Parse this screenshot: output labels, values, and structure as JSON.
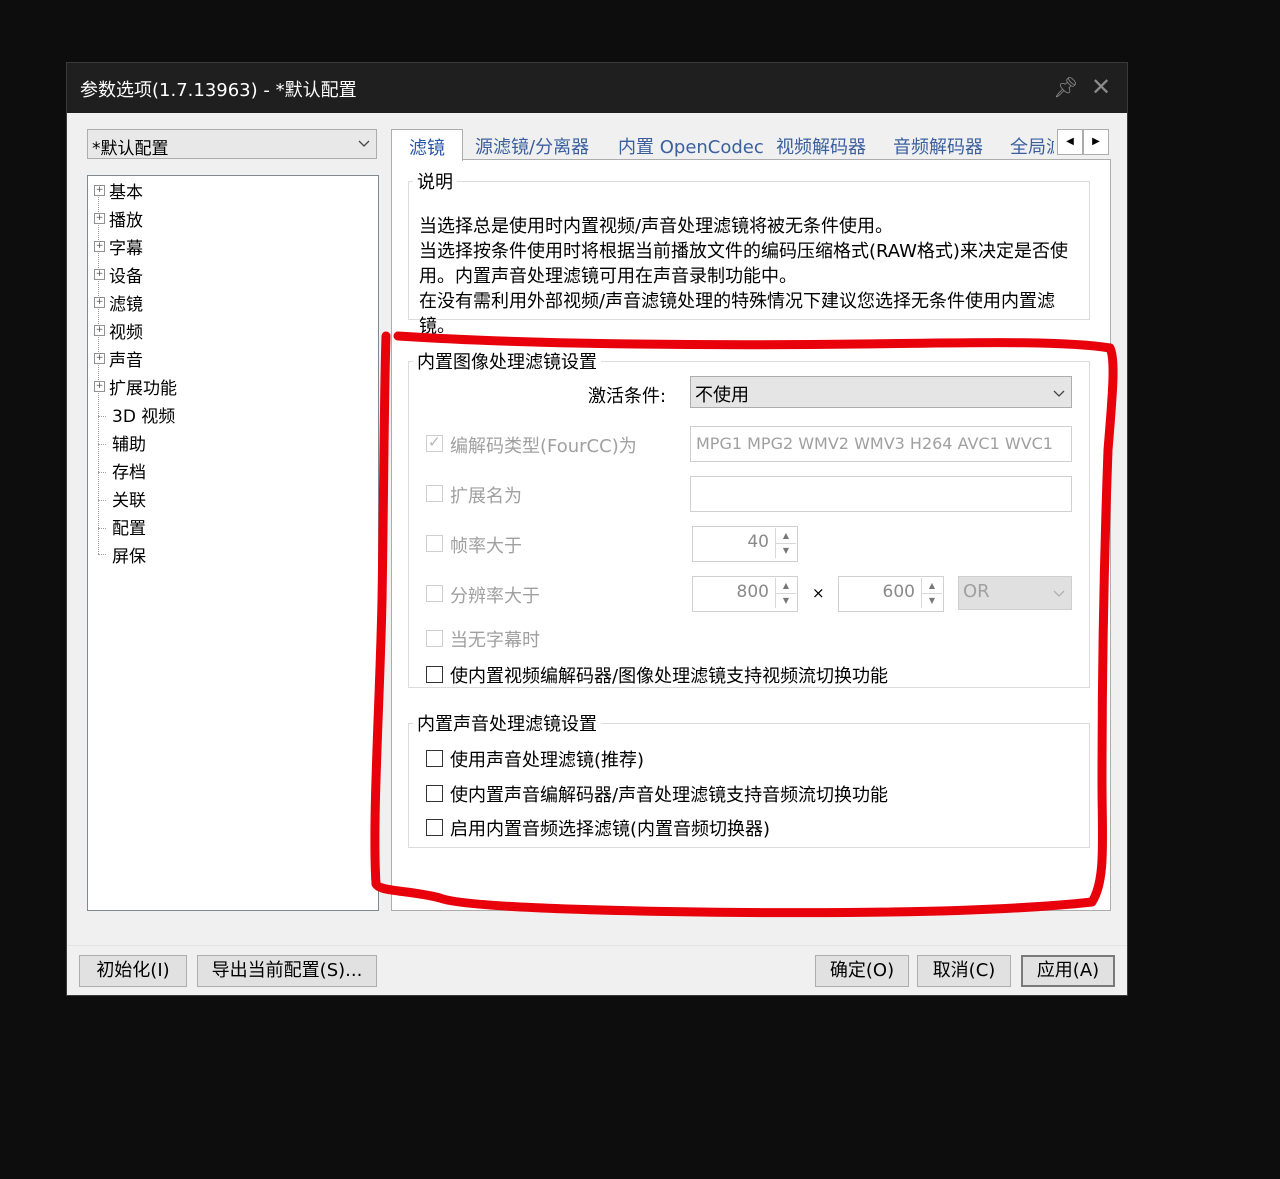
{
  "window": {
    "title": "参数选项(1.7.13963) - *默认配置",
    "pin_icon": "pin-icon",
    "close_icon": "close-icon"
  },
  "profile": {
    "value": "*默认配置"
  },
  "tree": {
    "items": [
      {
        "label": "基本",
        "expandable": true
      },
      {
        "label": "播放",
        "expandable": true
      },
      {
        "label": "字幕",
        "expandable": true
      },
      {
        "label": "设备",
        "expandable": true
      },
      {
        "label": "滤镜",
        "expandable": true
      },
      {
        "label": "视频",
        "expandable": true
      },
      {
        "label": "声音",
        "expandable": true
      },
      {
        "label": "扩展功能",
        "expandable": true
      },
      {
        "label": "3D 视频",
        "expandable": false
      },
      {
        "label": "辅助",
        "expandable": false
      },
      {
        "label": "存档",
        "expandable": false
      },
      {
        "label": "关联",
        "expandable": false
      },
      {
        "label": "配置",
        "expandable": false
      },
      {
        "label": "屏保",
        "expandable": false
      }
    ]
  },
  "tabs": [
    {
      "label": "滤镜",
      "active": true
    },
    {
      "label": "源滤镜/分离器"
    },
    {
      "label": "内置 OpenCodec"
    },
    {
      "label": "视频解码器"
    },
    {
      "label": "音频解码器"
    },
    {
      "label": "全局滤"
    }
  ],
  "description": {
    "legend": "说明",
    "lines": [
      "当选择总是使用时内置视频/声音处理滤镜将被无条件使用。",
      "当选择按条件使用时将根据当前播放文件的编码压缩格式(RAW格式)来决定是否使用。内置声音处理滤镜可用在声音录制功能中。",
      "在没有需利用外部视频/声音滤镜处理的特殊情况下建议您选择无条件使用内置滤镜。"
    ]
  },
  "image_filter": {
    "legend": "内置图像处理滤镜设置",
    "activation_label": "激活条件:",
    "activation_value": "不使用",
    "fourcc_label": "编解码类型(FourCC)为",
    "fourcc_value": "MPG1 MPG2 WMV2 WMV3 H264 AVC1 WVC1",
    "ext_label": "扩展名为",
    "ext_value": "",
    "fps_label": "帧率大于",
    "fps_value": "40",
    "res_label": "分辨率大于",
    "res_w": "800",
    "res_x": "×",
    "res_h": "600",
    "res_op": "OR",
    "nosub_label": "当无字幕时",
    "switch_label": "使内置视频编解码器/图像处理滤镜支持视频流切换功能"
  },
  "audio_filter": {
    "legend": "内置声音处理滤镜设置",
    "use_label": "使用声音处理滤镜(推荐)",
    "switch_label": "使内置声音编解码器/声音处理滤镜支持音频流切换功能",
    "selector_label": "启用内置音频选择滤镜(内置音频切换器)"
  },
  "buttons": {
    "init": "初始化(I)",
    "export": "导出当前配置(S)...",
    "ok": "确定(O)",
    "cancel": "取消(C)",
    "apply": "应用(A)"
  },
  "annotation_color": "#e8000b"
}
